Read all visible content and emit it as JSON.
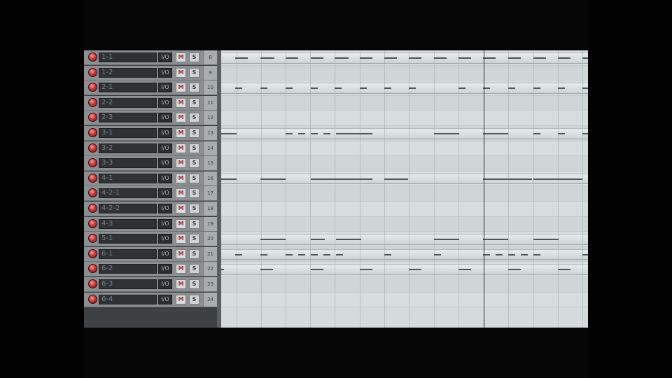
{
  "tracks": [
    {
      "name": "1-1",
      "io": "I/O",
      "mute": "M",
      "solo": "S",
      "num": "8"
    },
    {
      "name": "1-2",
      "io": "I/O",
      "mute": "M",
      "solo": "S",
      "num": "9"
    },
    {
      "name": "2-1",
      "io": "I/O",
      "mute": "M",
      "solo": "S",
      "num": "10"
    },
    {
      "name": "2-2",
      "io": "I/O",
      "mute": "M",
      "solo": "S",
      "num": "11"
    },
    {
      "name": "2-3",
      "io": "I/O",
      "mute": "M",
      "solo": "S",
      "num": "12"
    },
    {
      "name": "3-1",
      "io": "I/O",
      "mute": "M",
      "solo": "S",
      "num": "13"
    },
    {
      "name": "3-2",
      "io": "I/O",
      "mute": "M",
      "solo": "S",
      "num": "14"
    },
    {
      "name": "3-3",
      "io": "I/O",
      "mute": "M",
      "solo": "S",
      "num": "15"
    },
    {
      "name": "4-1",
      "io": "I/O",
      "mute": "M",
      "solo": "S",
      "num": "16"
    },
    {
      "name": "4-2-1",
      "io": "I/O",
      "mute": "M",
      "solo": "S",
      "num": "17"
    },
    {
      "name": "4-2-2",
      "io": "I/O",
      "mute": "M",
      "solo": "S",
      "num": "18"
    },
    {
      "name": "4-3",
      "io": "I/O",
      "mute": "M",
      "solo": "S",
      "num": "19"
    },
    {
      "name": "5-1",
      "io": "I/O",
      "mute": "M",
      "solo": "S",
      "num": "20"
    },
    {
      "name": "6-1",
      "io": "I/O",
      "mute": "M",
      "solo": "S",
      "num": "21"
    },
    {
      "name": "6-2",
      "io": "I/O",
      "mute": "M",
      "solo": "S",
      "num": "22"
    },
    {
      "name": "6-3",
      "io": "I/O",
      "mute": "M",
      "solo": "S",
      "num": "23"
    },
    {
      "name": "6-4",
      "io": "I/O",
      "mute": "M",
      "solo": "S",
      "num": "24"
    }
  ],
  "icons": {
    "record_arm": "record-arm-icon"
  },
  "colors": {
    "record_arm": "#c43a3a",
    "arrange_background": "#d5dbdc",
    "midi_note": "#4f5558",
    "track_panel": "#8b8f92"
  }
}
